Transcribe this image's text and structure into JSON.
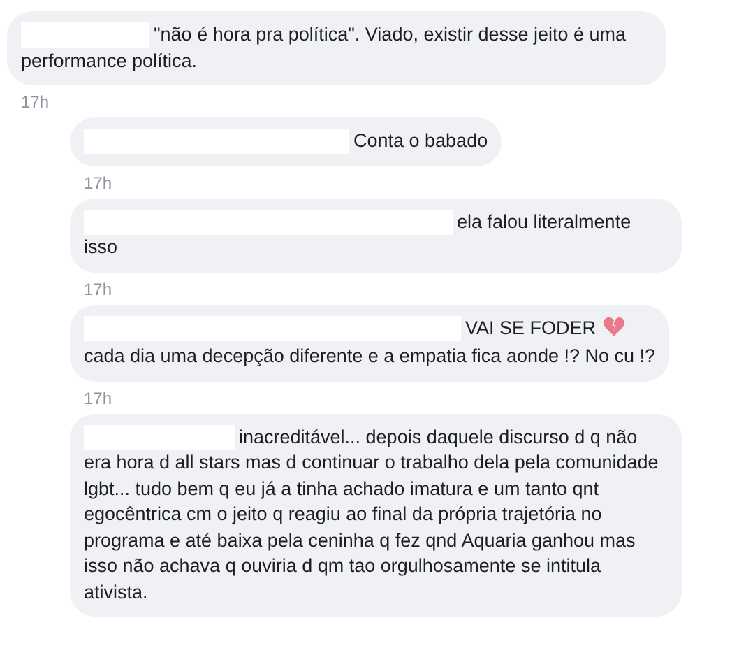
{
  "comments": [
    {
      "kind": "comment",
      "name_hidden": true,
      "text": "\"não é hora pra política\". Viado, existir desse jeito é uma performance política.",
      "broken_heart": false,
      "time": "17h"
    },
    {
      "kind": "reply",
      "name_hidden": true,
      "text": "Conta o babado",
      "broken_heart": false,
      "time": "17h"
    },
    {
      "kind": "reply",
      "name_hidden": true,
      "text": "ela falou literalmente isso",
      "broken_heart": false,
      "time": "17h"
    },
    {
      "kind": "reply",
      "name_hidden": true,
      "text": "VAI SE FODER",
      "broken_heart": true,
      "text_after": "cada dia uma decepção diferente e a empatia fica aonde !? No cu !?",
      "time": "17h"
    },
    {
      "kind": "reply",
      "name_hidden": true,
      "text": "inacreditável... depois daquele discurso d q não era hora d all stars mas d continuar o trabalho dela pela comunidade lgbt... tudo bem q eu já a tinha achado imatura e um tanto qnt egocêntrica cm o jeito q reagiu ao final da própria trajetória no programa e até baixa pela ceninha q fez qnd Aquaria ganhou mas isso não achava q ouviria d qm tao orgulhosamente se intitula ativista.",
      "broken_heart": false
    }
  ]
}
